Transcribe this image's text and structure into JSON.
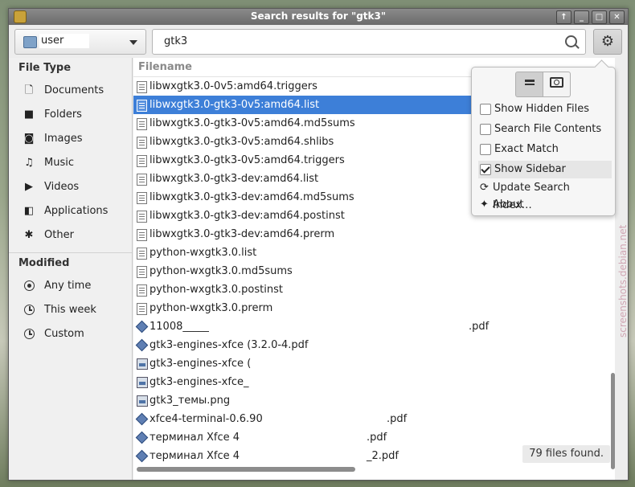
{
  "window": {
    "title": "Search results for \"gtk3\"",
    "buttons": [
      "↑",
      "_",
      "□",
      "✕"
    ]
  },
  "toolbar": {
    "location": "user",
    "search_value": "gtk3"
  },
  "sidebar": {
    "file_type_heading": "File Type",
    "file_types": [
      {
        "label": "Documents",
        "icon": "document-icon"
      },
      {
        "label": "Folders",
        "icon": "folder-icon"
      },
      {
        "label": "Images",
        "icon": "camera-icon"
      },
      {
        "label": "Music",
        "icon": "music-icon"
      },
      {
        "label": "Videos",
        "icon": "video-icon"
      },
      {
        "label": "Applications",
        "icon": "applications-icon"
      },
      {
        "label": "Other",
        "icon": "other-icon"
      }
    ],
    "modified_heading": "Modified",
    "modified": [
      {
        "label": "Any time",
        "selected": true
      },
      {
        "label": "This week",
        "selected": false
      },
      {
        "label": "Custom",
        "selected": false
      }
    ]
  },
  "filelist": {
    "column": "Filename",
    "rows": [
      {
        "name": "libwxgtk3.0-0v5:amd64.triggers",
        "icon": "text",
        "selected": false
      },
      {
        "name": "libwxgtk3.0-gtk3-0v5:amd64.list",
        "icon": "text",
        "selected": true
      },
      {
        "name": "libwxgtk3.0-gtk3-0v5:amd64.md5sums",
        "icon": "text",
        "selected": false
      },
      {
        "name": "libwxgtk3.0-gtk3-0v5:amd64.shlibs",
        "icon": "text",
        "selected": false
      },
      {
        "name": "libwxgtk3.0-gtk3-0v5:amd64.triggers",
        "icon": "text",
        "selected": false
      },
      {
        "name": "libwxgtk3.0-gtk3-dev:amd64.list",
        "icon": "text",
        "selected": false
      },
      {
        "name": "libwxgtk3.0-gtk3-dev:amd64.md5sums",
        "icon": "text",
        "selected": false
      },
      {
        "name": "libwxgtk3.0-gtk3-dev:amd64.postinst",
        "icon": "text",
        "selected": false
      },
      {
        "name": "libwxgtk3.0-gtk3-dev:amd64.prerm",
        "icon": "text",
        "selected": false
      },
      {
        "name": "python-wxgtk3.0.list",
        "icon": "text",
        "selected": false
      },
      {
        "name": "python-wxgtk3.0.md5sums",
        "icon": "text",
        "selected": false
      },
      {
        "name": "python-wxgtk3.0.postinst",
        "icon": "text",
        "selected": false
      },
      {
        "name": "python-wxgtk3.0.prerm",
        "icon": "text",
        "selected": false
      },
      {
        "name": "11008_____",
        "ext": ".pdf",
        "icon": "pdf",
        "selected": false
      },
      {
        "name": "gtk3-engines-xfce (3.2.0-4.pdf",
        "icon": "pdf",
        "selected": false
      },
      {
        "name": "gtk3-engines-xfce (",
        "icon": "image",
        "selected": false
      },
      {
        "name": "gtk3-engines-xfce_",
        "icon": "image",
        "selected": false
      },
      {
        "name": "gtk3_темы.png",
        "icon": "image",
        "selected": false
      },
      {
        "name": "xfce4-terminal-0.6.90",
        "ext": ".pdf",
        "icon": "pdf",
        "selected": false
      },
      {
        "name": "терминал Xfce 4",
        "ext": ".pdf",
        "icon": "pdf",
        "selected": false
      },
      {
        "name": "терминал Xfce 4",
        "ext": "_2.pdf",
        "icon": "pdf",
        "selected": false
      }
    ],
    "status": "79 files found."
  },
  "popover": {
    "options": [
      {
        "label": "Show Hidden Files",
        "checked": false
      },
      {
        "label": "Search File Contents",
        "checked": false
      },
      {
        "label": "Exact Match",
        "checked": false
      },
      {
        "label": "Show Sidebar",
        "checked": true
      }
    ],
    "update_label": "Update Search Index…",
    "about_label": "About"
  },
  "watermark": "screenshots.debian.net"
}
